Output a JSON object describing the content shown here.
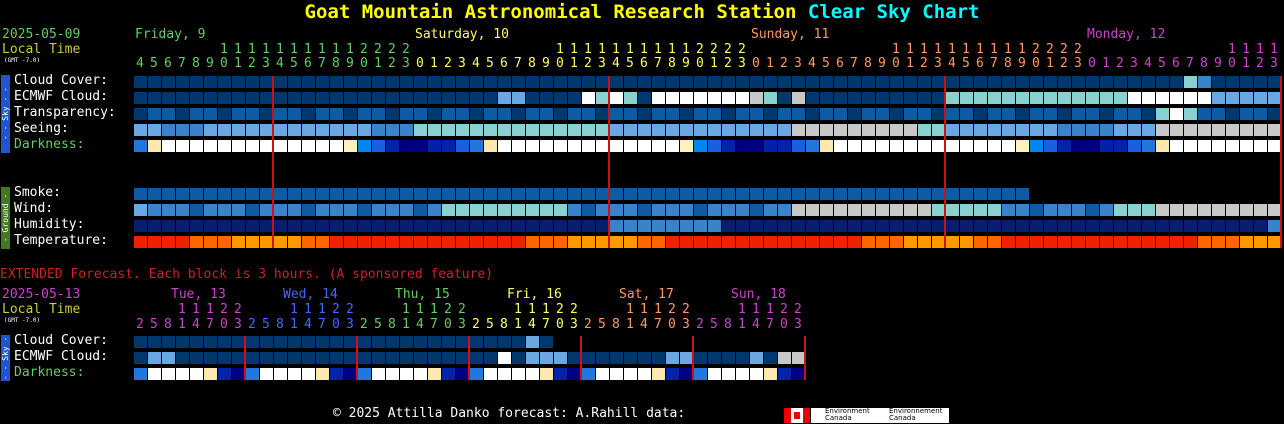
{
  "title": {
    "part1": "Goat Mountain Astronomical Research Station",
    "part2": "Clear Sky Chart"
  },
  "header": {
    "date": "2025-05-09",
    "local_time": "Local Time",
    "gmt": "(GMT -7.0)"
  },
  "days": [
    {
      "label": "Friday, 9",
      "color": "#66cc66"
    },
    {
      "label": "Saturday, 10",
      "color": "#ffff66"
    },
    {
      "label": "Sunday, 11",
      "color": "#ff9966"
    },
    {
      "label": "Monday, 12",
      "color": "#cc44cc"
    }
  ],
  "hours_tens": "1 1 1 1 1 1 1 2 2 2 2",
  "rows": {
    "cloud_cover": "Cloud Cover:",
    "ecmwf_cloud": "ECMWF Cloud:",
    "transparency": "Transparency:",
    "seeing": "Seeing:",
    "darkness": "Darkness:",
    "smoke": "Smoke:",
    "wind": "Wind:",
    "humidity": "Humidity:",
    "temperature": "Temperature:"
  },
  "sidebar": {
    "sky": "- - Sky - -",
    "ground": "- Ground -"
  },
  "extended": {
    "banner": "EXTENDED Forecast. Each block is 3 hours. (A sponsored feature)",
    "date": "2025-05-13",
    "local_time": "Local Time",
    "gmt": "(GMT -7.0)",
    "days": [
      {
        "label": "Tue, 13",
        "color": "#cc44cc"
      },
      {
        "label": "Wed, 14",
        "color": "#4466ff"
      },
      {
        "label": "Thu, 15",
        "color": "#66cc66"
      },
      {
        "label": "Fri, 16",
        "color": "#ffff66"
      },
      {
        "label": "Sat, 17",
        "color": "#ff9966"
      },
      {
        "label": "Sun, 18",
        "color": "#cc44cc"
      }
    ],
    "tens": "1 1 1 2 2",
    "ones": "2 5 8 1 4 7 0 3",
    "rows": {
      "cloud_cover": "Cloud Cover:",
      "ecmwf_cloud": "ECMWF Cloud:",
      "darkness": "Darkness:"
    }
  },
  "footer": {
    "text": "© 2025 Attilla Danko  forecast: A.Rahill  data:",
    "env1": "Environment Canada",
    "env2": "Environnement Canada"
  },
  "colors": {
    "label_yellow": "#cccc33",
    "date_green": "#66cc66",
    "extended_red": "#cc2222",
    "darkness_label": "#66cc66"
  }
}
